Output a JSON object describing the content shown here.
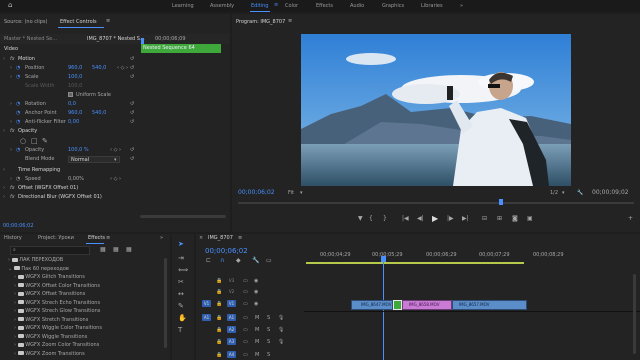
{
  "topbar": {
    "home_icon": "home-icon",
    "workspaces": [
      "Learning",
      "Assembly",
      "Editing",
      "Color",
      "Effects",
      "Audio",
      "Graphics",
      "Libraries"
    ],
    "active_workspace": "Editing",
    "more": "»"
  },
  "effect_controls": {
    "tab_source": "Source: (no clips)",
    "tab_title": "Effect Controls",
    "menu_icon": "≡",
    "clip_selector": "Master * Nested Se...",
    "clip_name": "IMG_8707 * Nested S...",
    "timecode_header": "00;00;06;09",
    "nested_label": "Nested Sequence 64",
    "section_video": "Video",
    "motion": "Motion",
    "position_label": "Position",
    "position_x": "960,0",
    "position_y": "540,0",
    "scale_label": "Scale",
    "scale_value": "100,0",
    "scale_width_label": "Scale Width",
    "scale_width_value": "100,0",
    "uniform_scale": "Uniform Scale",
    "rotation_label": "Rotation",
    "rotation_value": "0,0",
    "anchor_label": "Anchor Point",
    "anchor_x": "960,0",
    "anchor_y": "540,0",
    "antiflicker_label": "Anti-flicker Filter",
    "antiflicker_value": "0,00",
    "opacity": "Opacity",
    "opacity_label": "Opacity",
    "opacity_value": "100,0 %",
    "blend_label": "Blend Mode",
    "blend_value": "Normal",
    "time_remapping": "Time Remapping",
    "speed_label": "Speed",
    "speed_value": "0,00%",
    "fx_offset": "Offset (WGFX Offset 01)",
    "fx_blur": "Directional Blur (WGFX Offset 01)",
    "footer_timecode": "00;00;06;02"
  },
  "program": {
    "title": "Program: IMG_8707",
    "menu_icon": "≡",
    "timecode": "00;00;06;02",
    "fit": "Fit",
    "ratio": "1/2",
    "duration": "00;00;09;02"
  },
  "effects_panel": {
    "tab_history": "History",
    "tab_project": "Project: Уроки",
    "tab_effects": "Effects",
    "more": "»",
    "search_placeholder": "",
    "tree": [
      "ЛАК ПЕРЕХОДОВ",
      "Пак 60 переходов",
      "WGFX Glitch Transitions",
      "WGFX Offset Color Transitions",
      "WGFX Offset Transitions",
      "WGFX Strech Echo Transitions",
      "WGFX Strech Glow Transitions",
      "WGFX Stretch Transitions",
      "WGFX Wiggle Color Transitions",
      "WGFX Wiggle Transitions",
      "WGFX Zoom Color Transitions",
      "WGFX Zoom Transitions"
    ]
  },
  "timeline": {
    "title": "IMG_8707",
    "menu_icon": "≡",
    "timecode": "00;00;06;02",
    "ruler": [
      "00;00;04;29",
      "00;00;05;29",
      "00;00;06;29",
      "00;00;07;29",
      "00;00;08;29"
    ],
    "tracks_video": [
      "V3",
      "V2",
      "V1"
    ],
    "tracks_audio": [
      "A1",
      "A2",
      "A3"
    ],
    "clip1": "IMG_8647.MOV",
    "clip2": "IMG_8658.MOV",
    "clip3": "IMG_8657.MOV"
  },
  "colors": {
    "accent": "#4a90ff",
    "nested_green": "#3fa83b",
    "clip_blue": "#5b8dc8",
    "clip_pink": "#c97bd6",
    "track_blue": "#2f5fae"
  }
}
